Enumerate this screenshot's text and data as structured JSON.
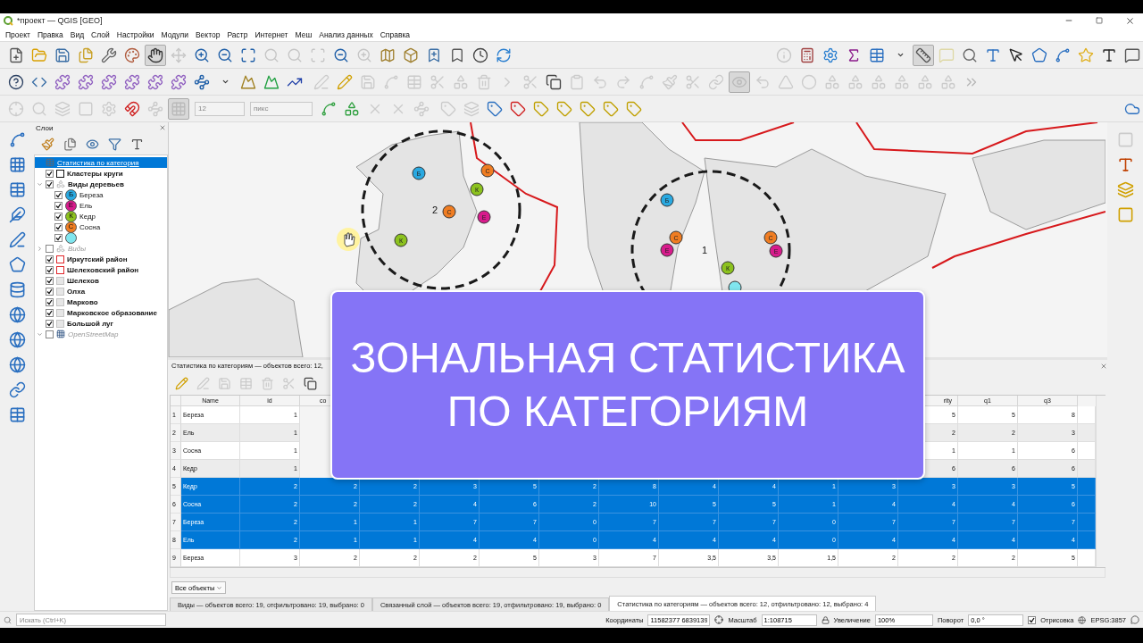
{
  "window": {
    "title": "*проект — QGIS [GEO]"
  },
  "menu": [
    "Проект",
    "Правка",
    "Вид",
    "Слой",
    "Настройки",
    "Модули",
    "Вектор",
    "Растр",
    "Интернет",
    "Меш",
    "Анализ данных",
    "Справка"
  ],
  "toolbars": [
    {
      "buttons": [
        {
          "disabled": false,
          "pressed": false
        },
        {
          "disabled": false,
          "pressed": false
        },
        {
          "disabled": false,
          "pressed": false
        },
        {
          "disabled": false,
          "pressed": false
        },
        {
          "disabled": false,
          "pressed": false
        },
        {
          "disabled": false,
          "pressed": false
        },
        {
          "disabled": false,
          "pressed": true
        },
        {
          "disabled": true,
          "pressed": false
        },
        {
          "disabled": false,
          "pressed": false
        },
        {
          "disabled": false,
          "pressed": false
        },
        {
          "disabled": false,
          "pressed": false
        },
        {
          "disabled": true,
          "pressed": false
        },
        {
          "disabled": true,
          "pressed": false
        },
        {
          "disabled": true,
          "pressed": false
        },
        {
          "disabled": false,
          "pressed": false
        },
        {
          "disabled": true,
          "pressed": false
        },
        {
          "disabled": false,
          "pressed": false
        },
        {
          "disabled": false,
          "pressed": false
        },
        {
          "disabled": false,
          "pressed": false
        },
        {
          "disabled": false,
          "pressed": false
        },
        {
          "disabled": false,
          "pressed": false
        },
        {
          "disabled": false,
          "pressed": false
        }
      ]
    },
    {
      "buttons": [
        {
          "disabled": true,
          "pressed": false
        },
        {
          "disabled": false,
          "pressed": false
        },
        {
          "disabled": false,
          "pressed": false
        },
        {
          "disabled": false,
          "pressed": false
        },
        {
          "disabled": false,
          "pressed": false
        },
        {
          "disabled": false,
          "pressed": false
        },
        {
          "disabled": false,
          "pressed": true
        },
        {
          "disabled": true,
          "pressed": false
        },
        {
          "disabled": false,
          "pressed": false
        },
        {
          "disabled": false,
          "pressed": false
        },
        {
          "disabled": false,
          "pressed": false
        },
        {
          "disabled": false,
          "pressed": false
        },
        {
          "disabled": false,
          "pressed": false
        },
        {
          "disabled": false,
          "pressed": false
        },
        {
          "disabled": false,
          "pressed": false
        },
        {
          "disabled": false,
          "pressed": false
        }
      ]
    },
    {
      "buttons": [
        {
          "disabled": false,
          "pressed": false
        },
        {
          "disabled": false,
          "pressed": false
        },
        {
          "disabled": false,
          "pressed": false
        },
        {
          "disabled": false,
          "pressed": false
        },
        {
          "disabled": false,
          "pressed": false
        },
        {
          "disabled": false,
          "pressed": false
        },
        {
          "disabled": false,
          "pressed": false
        },
        {
          "disabled": false,
          "pressed": false
        },
        {
          "disabled": false,
          "pressed": false
        },
        {
          "disabled": false,
          "pressed": false
        },
        {
          "disabled": false,
          "pressed": false
        },
        {
          "disabled": false,
          "pressed": false
        },
        {
          "disabled": false,
          "pressed": false
        }
      ]
    },
    {
      "buttons": [
        {
          "disabled": true,
          "pressed": false
        },
        {
          "disabled": false,
          "pressed": false
        },
        {
          "disabled": true,
          "pressed": false
        },
        {
          "disabled": true,
          "pressed": false
        },
        {
          "disabled": true,
          "pressed": false
        },
        {
          "disabled": true,
          "pressed": false
        },
        {
          "disabled": true,
          "pressed": false
        },
        {
          "disabled": true,
          "pressed": false
        },
        {
          "disabled": true,
          "pressed": false
        },
        {
          "disabled": true,
          "pressed": false
        },
        {
          "disabled": false,
          "pressed": false
        },
        {
          "disabled": true,
          "pressed": false
        },
        {
          "disabled": true,
          "pressed": false
        },
        {
          "disabled": true,
          "pressed": false
        },
        {
          "disabled": true,
          "pressed": false
        },
        {
          "disabled": true,
          "pressed": false
        },
        {
          "disabled": true,
          "pressed": false
        },
        {
          "disabled": true,
          "pressed": false
        },
        {
          "disabled": true,
          "pressed": true
        },
        {
          "disabled": true,
          "pressed": false
        },
        {
          "disabled": true,
          "pressed": false
        },
        {
          "disabled": true,
          "pressed": false
        },
        {
          "disabled": true,
          "pressed": false
        },
        {
          "disabled": true,
          "pressed": false
        },
        {
          "disabled": true,
          "pressed": false
        },
        {
          "disabled": true,
          "pressed": false
        },
        {
          "disabled": true,
          "pressed": false
        },
        {
          "disabled": true,
          "pressed": false
        },
        {
          "disabled": true,
          "pressed": false
        }
      ]
    },
    {
      "buttons": [
        {
          "disabled": true,
          "pressed": false
        },
        {
          "disabled": true,
          "pressed": false
        },
        {
          "disabled": true,
          "pressed": false
        },
        {
          "disabled": true,
          "pressed": false
        },
        {
          "disabled": true,
          "pressed": false
        },
        {
          "disabled": false,
          "pressed": false
        },
        {
          "disabled": true,
          "pressed": false
        },
        {
          "disabled": true,
          "pressed": true
        }
      ]
    },
    {
      "buttons": [
        {
          "disabled": false,
          "pressed": false
        },
        {
          "disabled": false,
          "pressed": false
        },
        {
          "disabled": true,
          "pressed": false
        },
        {
          "disabled": true,
          "pressed": false
        },
        {
          "disabled": true,
          "pressed": false
        }
      ]
    },
    {
      "buttons": [
        {
          "disabled": true,
          "pressed": false
        },
        {
          "disabled": true,
          "pressed": false
        },
        {
          "disabled": false,
          "pressed": false
        },
        {
          "disabled": false,
          "pressed": false
        },
        {
          "disabled": false,
          "pressed": false
        },
        {
          "disabled": false,
          "pressed": false
        },
        {
          "disabled": false,
          "pressed": false
        },
        {
          "disabled": false,
          "pressed": false
        },
        {
          "disabled": false,
          "pressed": false
        }
      ]
    },
    {
      "buttons": [
        {
          "disabled": false,
          "pressed": false
        }
      ]
    }
  ],
  "snapping": {
    "tolerance": "12",
    "units": "пикс"
  },
  "left_toolbar": [
    {
      "disabled": false
    },
    {
      "disabled": false
    },
    {
      "disabled": false
    },
    {
      "disabled": false
    },
    {
      "disabled": false
    },
    {
      "disabled": false
    },
    {
      "disabled": false
    },
    {
      "disabled": false
    },
    {
      "disabled": false
    },
    {
      "disabled": false
    },
    {
      "disabled": false
    },
    {
      "disabled": false
    }
  ],
  "right_toolbar": [
    {
      "disabled": true
    },
    {
      "disabled": false
    },
    {
      "disabled": false
    },
    {
      "disabled": false
    }
  ],
  "layers_panel": {
    "title": "Слои",
    "toolbar": [
      {
        "disabled": false
      },
      {
        "disabled": false
      },
      {
        "disabled": false
      },
      {
        "disabled": false
      },
      {
        "disabled": false
      }
    ],
    "layers": [
      {
        "kind": "table",
        "name": "Статистика по категория",
        "selected": true,
        "dimmed": false
      },
      {
        "kind": "line",
        "name": "Кластеры круги",
        "checked": true,
        "selected": false,
        "dimmed": false
      },
      {
        "kind": "categorized",
        "name": "Виды деревьев",
        "checked": true,
        "expanded": true,
        "selected": false,
        "dimmed": false,
        "children": [
          {
            "label": "Береза",
            "letter": "Б",
            "color": "#29a9e1",
            "checked": true
          },
          {
            "label": "Ель",
            "letter": "Е",
            "color": "#d81b8c",
            "checked": true
          },
          {
            "label": "Кедр",
            "letter": "К",
            "color": "#8cc21e",
            "checked": true
          },
          {
            "label": "Сосна",
            "letter": "С",
            "color": "#f07d22",
            "checked": true
          },
          {
            "color": "#80e6ef",
            "checked": true
          }
        ]
      },
      {
        "kind": "categorized",
        "name": "Виды",
        "checked": false,
        "expanded": false,
        "selected": false,
        "dimmed": true
      },
      {
        "kind": "polygon",
        "name": "Иркутский район",
        "checked": true,
        "selected": false,
        "dimmed": false,
        "color": "#e0262a"
      },
      {
        "kind": "polygon",
        "name": "Шелеховский район",
        "checked": true,
        "selected": false,
        "dimmed": false,
        "color": "#e0262a"
      },
      {
        "kind": "polygon",
        "name": "Шелехов",
        "checked": true,
        "selected": false,
        "dimmed": false,
        "color": "#c4c4c4"
      },
      {
        "kind": "polygon",
        "name": "Олха",
        "checked": true,
        "selected": false,
        "dimmed": false,
        "color": "#c4c4c4"
      },
      {
        "kind": "polygon",
        "name": "Марково",
        "checked": true,
        "selected": false,
        "dimmed": false,
        "color": "#c4c4c4"
      },
      {
        "kind": "polygon",
        "name": "Марковское образование",
        "checked": true,
        "selected": false,
        "dimmed": false,
        "color": "#c4c4c4"
      },
      {
        "kind": "polygon",
        "name": "Большой луг",
        "checked": true,
        "selected": false,
        "dimmed": false,
        "color": "#c4c4c4"
      },
      {
        "kind": "raster",
        "name": "OpenStreetMap",
        "checked": false,
        "expanded": true,
        "selected": false,
        "dimmed": true
      }
    ]
  },
  "map": {
    "clusters": [
      {
        "label": "2",
        "markers": [
          {
            "letter": "Б",
            "color": "#29a9e1"
          },
          {
            "letter": "С",
            "color": "#f07d22"
          },
          {
            "letter": "К",
            "color": "#8cc21e"
          },
          {
            "letter": "С",
            "color": "#f07d22"
          },
          {
            "letter": "Е",
            "color": "#d81b8c"
          },
          {
            "letter": "К",
            "color": "#8cc21e"
          }
        ]
      },
      {
        "label": "1",
        "markers": [
          {
            "letter": "Б",
            "color": "#29a9e1"
          },
          {
            "letter": "С",
            "color": "#f07d22"
          },
          {
            "letter": "Е",
            "color": "#d81b8c"
          },
          {
            "letter": "С",
            "color": "#f07d22"
          },
          {
            "letter": "Е",
            "color": "#d81b8c"
          },
          {
            "letter": "К",
            "color": "#8cc21e"
          },
          {
            "color": "#80e6ef"
          }
        ]
      }
    ]
  },
  "banner": {
    "lines": [
      "ЗОНАЛЬНАЯ СТАТИСТИКА",
      "ПО КАТЕГОРИЯМ"
    ]
  },
  "attribute_table": {
    "title": "Статистика по категориям — объектов всего: 12,",
    "toolbar": [
      {
        "disabled": false
      },
      {
        "disabled": true
      },
      {
        "disabled": true
      },
      {
        "disabled": true
      },
      {
        "disabled": true
      },
      {
        "disabled": true
      },
      {
        "disabled": false
      }
    ],
    "columns": {
      "leading": [
        "Name",
        "id",
        "co"
      ],
      "trailing": [
        "rity",
        "q1",
        "q3"
      ]
    },
    "rows": [
      {
        "number": "1",
        "name": "Береза",
        "selected": false,
        "leading": [
          "1"
        ],
        "trailing": [
          "5",
          "5",
          "8"
        ]
      },
      {
        "number": "2",
        "name": "Ель",
        "selected": false,
        "leading": [
          "1"
        ],
        "trailing": [
          "2",
          "2",
          "3"
        ]
      },
      {
        "number": "3",
        "name": "Сосна",
        "selected": false,
        "leading": [
          "1"
        ],
        "trailing": [
          "1",
          "1",
          "6"
        ]
      },
      {
        "number": "4",
        "name": "Кедр",
        "selected": false,
        "leading": [
          "1"
        ],
        "trailing": [
          "6",
          "6",
          "6"
        ]
      },
      {
        "number": "5",
        "name": "Кедр",
        "selected": true,
        "values": [
          "2",
          "2",
          "2",
          "3",
          "5",
          "2",
          "8",
          "4",
          "4",
          "1",
          "3",
          "3",
          "3",
          "5"
        ]
      },
      {
        "number": "6",
        "name": "Сосна",
        "selected": true,
        "values": [
          "2",
          "2",
          "2",
          "4",
          "6",
          "2",
          "10",
          "5",
          "5",
          "1",
          "4",
          "4",
          "4",
          "6"
        ]
      },
      {
        "number": "7",
        "name": "Береза",
        "selected": true,
        "values": [
          "2",
          "1",
          "1",
          "7",
          "7",
          "0",
          "7",
          "7",
          "7",
          "0",
          "7",
          "7",
          "7",
          "7"
        ]
      },
      {
        "number": "8",
        "name": "Ель",
        "selected": true,
        "values": [
          "2",
          "1",
          "1",
          "4",
          "4",
          "0",
          "4",
          "4",
          "4",
          "0",
          "4",
          "4",
          "4",
          "4"
        ]
      },
      {
        "number": "9",
        "name": "Береза",
        "selected": false,
        "values": [
          "3",
          "2",
          "2",
          "2",
          "5",
          "3",
          "7",
          "3,5",
          "3,5",
          "1,5",
          "2",
          "2",
          "2",
          "5"
        ]
      }
    ],
    "filter_button": "Все объекты",
    "tabs": [
      {
        "label": "Виды — объектов всего: 19, отфильтровано: 19, выбрано: 0",
        "selected": false
      },
      {
        "label": "Связанный слой — объектов всего: 19, отфильтровано: 19, выбрано: 0",
        "selected": false
      },
      {
        "label": "Статистика по категориям — объектов всего: 12, отфильтровано: 12, выбрано: 4",
        "selected": true
      }
    ]
  },
  "status_bar": {
    "search": {
      "placeholder": "Искать (Ctrl+K)"
    },
    "coordinates_label": "Координаты",
    "coordinates": "11582377 6839139",
    "scale_label": "Масштаб",
    "scale": "1:108715",
    "magnifier_label": "Увеличение",
    "magnifier": "100%",
    "rotation_label": "Поворот",
    "rotation": "0,0 °",
    "render": {
      "label": "Отрисовка",
      "checked": true
    },
    "crs": "EPSG:3857"
  }
}
